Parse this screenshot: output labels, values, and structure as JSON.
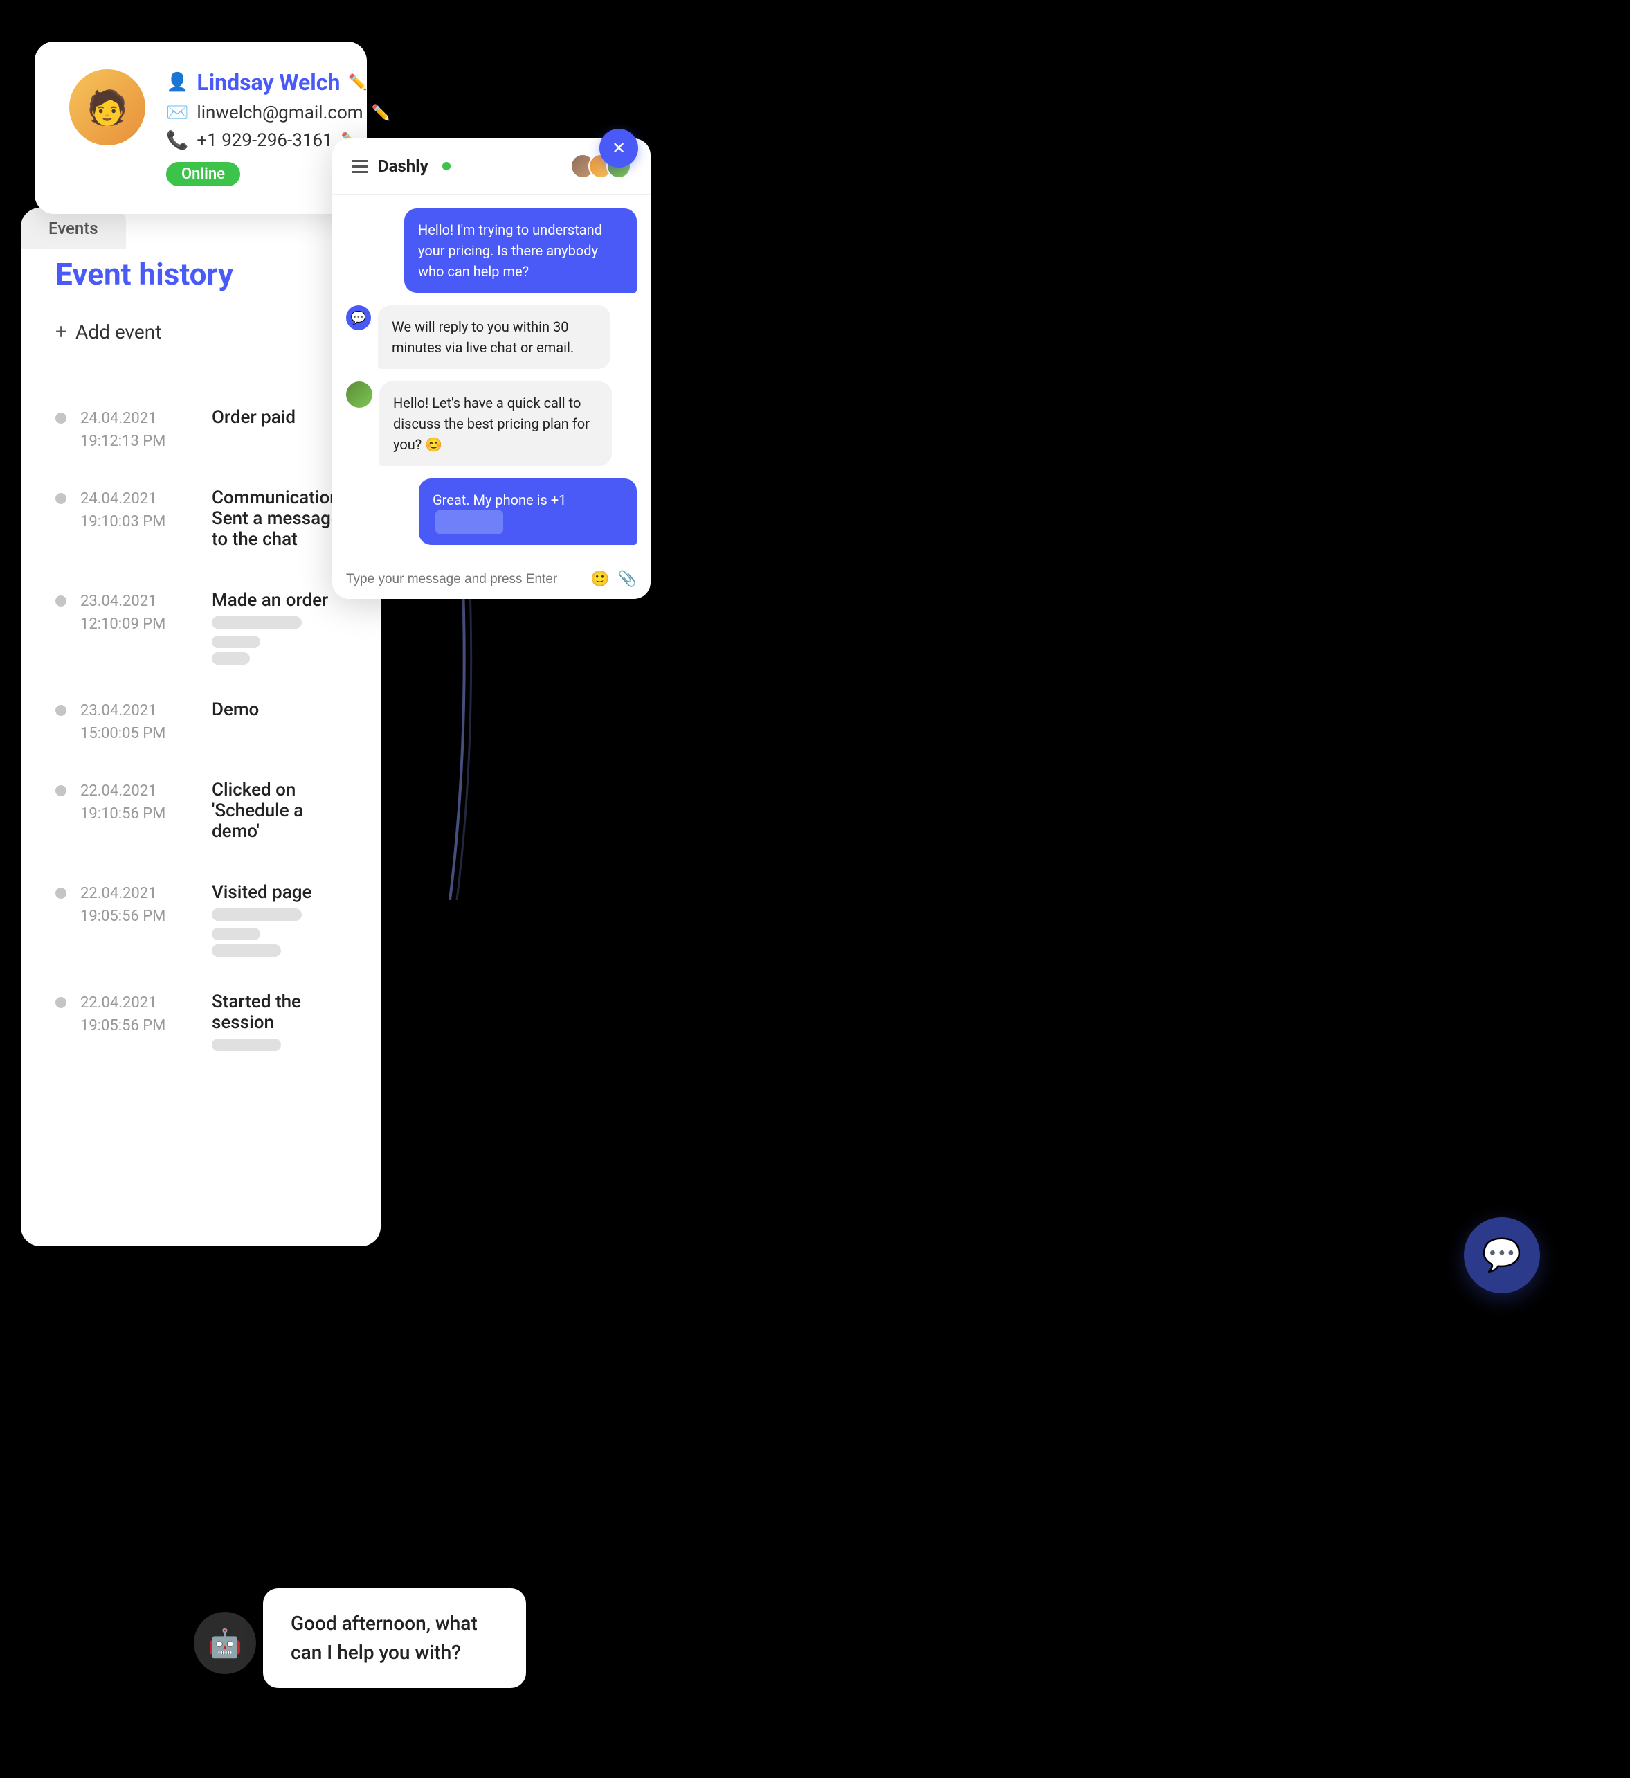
{
  "contact": {
    "name": "Lindsay Welch",
    "email": "linwelch@gmail.com",
    "phone": "+1 929-296-3161",
    "status": "Online"
  },
  "events": {
    "tab_label": "Events",
    "title": "Event history",
    "add_button": "Add event",
    "items": [
      {
        "date": "24.04.2021",
        "time": "19:12:13 PM",
        "name": "Order paid",
        "tags": []
      },
      {
        "date": "24.04.2021",
        "time": "19:10:03 PM",
        "name": "Communications: Sent a message to the chat",
        "tags": []
      },
      {
        "date": "23.04.2021",
        "time": "12:10:09 PM",
        "name": "Made an order",
        "tags": [
          "lg",
          "md",
          "sm"
        ]
      },
      {
        "date": "23.04.2021",
        "time": "15:00:05 PM",
        "name": "Demo",
        "tags": []
      },
      {
        "date": "22.04.2021",
        "time": "19:10:56 PM",
        "name": "Clicked on 'Schedule a demo'",
        "tags": []
      },
      {
        "date": "22.04.2021",
        "time": "19:05:56 PM",
        "name": "Visited page",
        "tags": [
          "xl",
          "md",
          "sm"
        ]
      },
      {
        "date": "22.04.2021",
        "time": "19:05:56 PM",
        "name": "Started the session",
        "tags": [
          "lg"
        ]
      }
    ]
  },
  "chat": {
    "title": "Dashly",
    "close_label": "×",
    "messages": [
      {
        "type": "sent",
        "text": "Hello! I'm trying to understand your pricing. Is there anybody who can help me?"
      },
      {
        "type": "received_bot",
        "text": "We will reply to you within 30 minutes via live chat or email."
      },
      {
        "type": "received_agent",
        "text": "Hello! Let's have a quick call to discuss the best pricing plan for you? 😊"
      },
      {
        "type": "sent",
        "text": "Great. My phone is +1"
      }
    ],
    "input_placeholder": "Type your message and press Enter"
  },
  "bot_greeting": "Good afternoon, what can I help you with?"
}
